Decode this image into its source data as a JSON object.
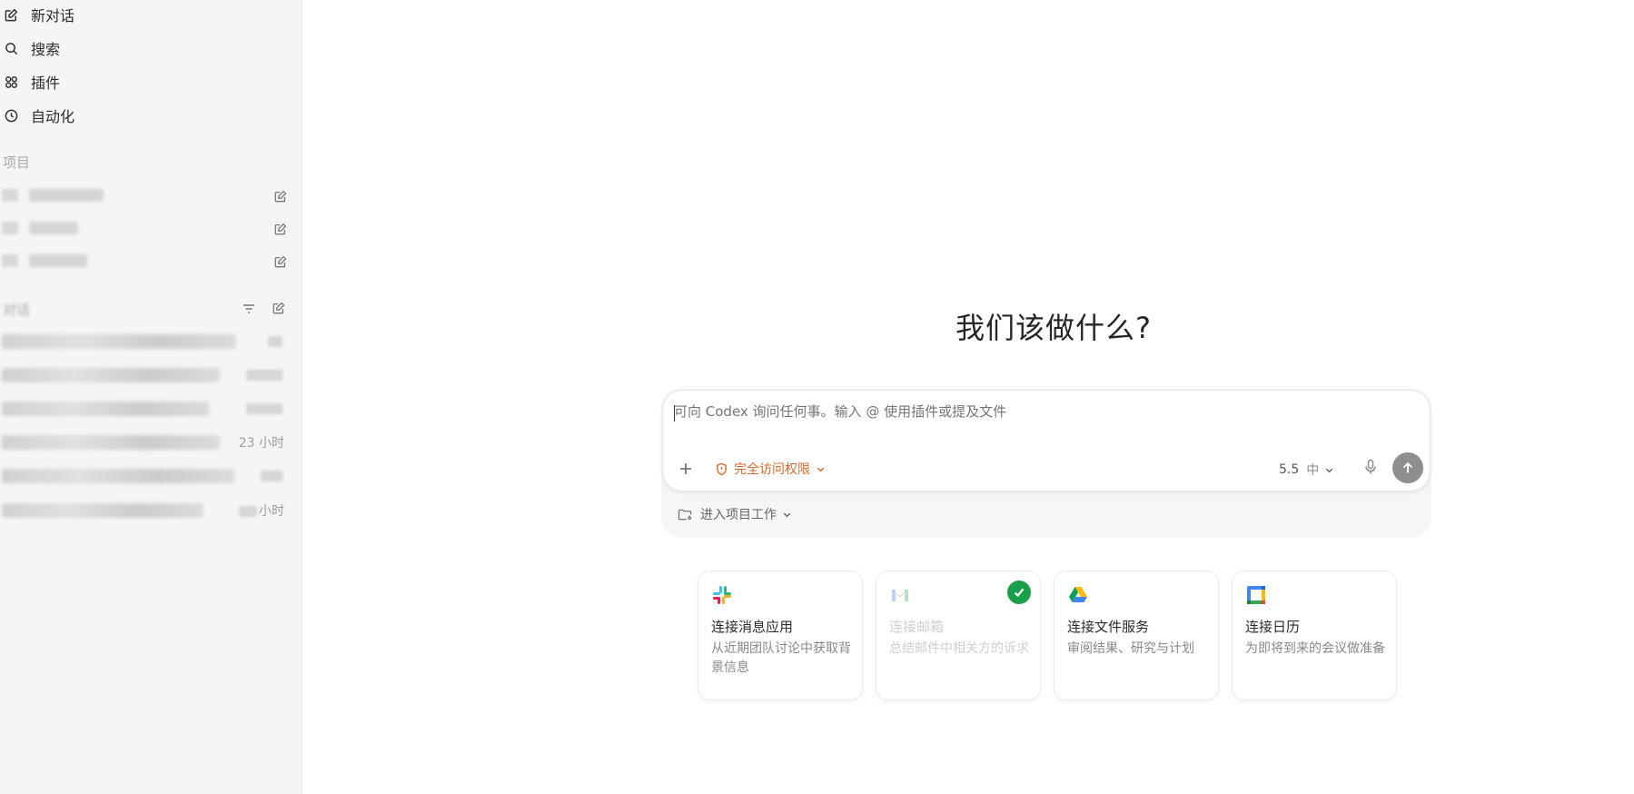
{
  "sidebar": {
    "nav": [
      {
        "label": "新对话",
        "icon": "edit-icon"
      },
      {
        "label": "搜索",
        "icon": "search-icon"
      },
      {
        "label": "插件",
        "icon": "plugins-icon"
      },
      {
        "label": "自动化",
        "icon": "clock-icon"
      }
    ],
    "projects_label": "项目",
    "threads_label": "对话",
    "threads": [
      {
        "time": ""
      },
      {
        "time": ""
      },
      {
        "time": ""
      },
      {
        "time": "23 小时"
      },
      {
        "time": ""
      },
      {
        "time": "小时"
      }
    ]
  },
  "main": {
    "title": "我们该做什么?",
    "composer": {
      "placeholder": "可向 Codex 询问任何事。输入 @ 使用插件或提及文件",
      "access_label": "完全访问权限",
      "model_version": "5.5",
      "model_effort": "中",
      "project_work_label": "进入项目工作"
    },
    "cards": [
      {
        "title": "连接消息应用",
        "desc": "从近期团队讨论中获取背景信息",
        "icon": "slack-icon",
        "connected": false
      },
      {
        "title": "连接邮箱",
        "desc": "总结邮件中相关方的诉求",
        "icon": "gmail-icon",
        "connected": true
      },
      {
        "title": "连接文件服务",
        "desc": "审阅结果、研究与计划",
        "icon": "google-drive-icon",
        "connected": false
      },
      {
        "title": "连接日历",
        "desc": "为即将到来的会议做准备",
        "icon": "google-calendar-icon",
        "connected": false
      }
    ]
  },
  "colors": {
    "accent_warning": "#d9682b",
    "connected_green": "#1aa04b",
    "sidebar_bg": "#f4f5f5"
  }
}
